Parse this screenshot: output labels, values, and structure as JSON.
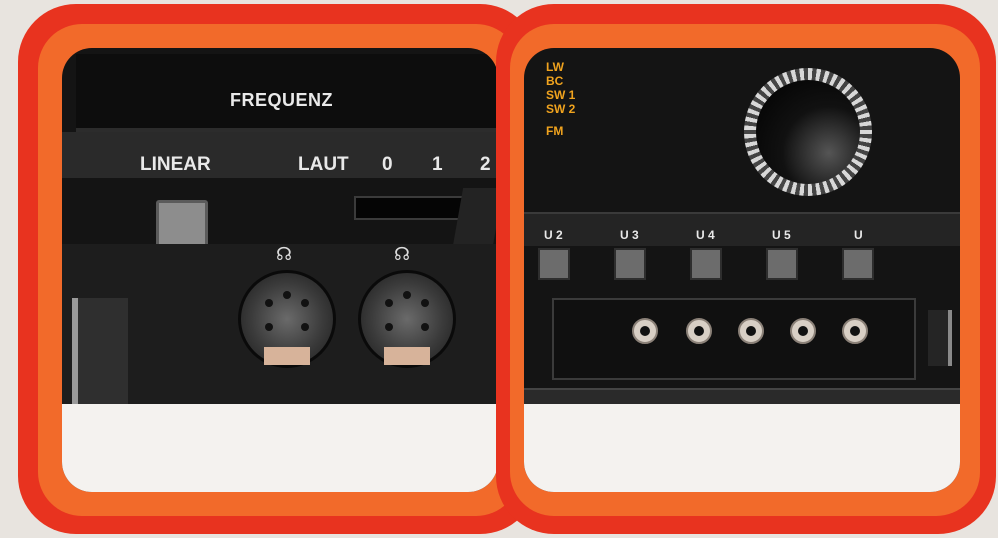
{
  "left_panel": {
    "display_label": "FREQUENZ",
    "button_label": "LINEAR",
    "volume_label": "LAUT",
    "volume_scale": [
      "0",
      "1",
      "2"
    ]
  },
  "right_panel": {
    "band_labels": [
      "LW",
      "BC",
      "SW 1",
      "SW 2",
      "FM"
    ],
    "preset_labels": [
      "U 2",
      "U 3",
      "U 4",
      "U 5",
      "U"
    ]
  },
  "colors": {
    "outer_frame": "#e8331f",
    "inner_frame": "#f26a2a",
    "band_text": "#f0a31e",
    "device_body": "#141414"
  },
  "icons": [
    "headphone-icon",
    "headphone-icon"
  ]
}
